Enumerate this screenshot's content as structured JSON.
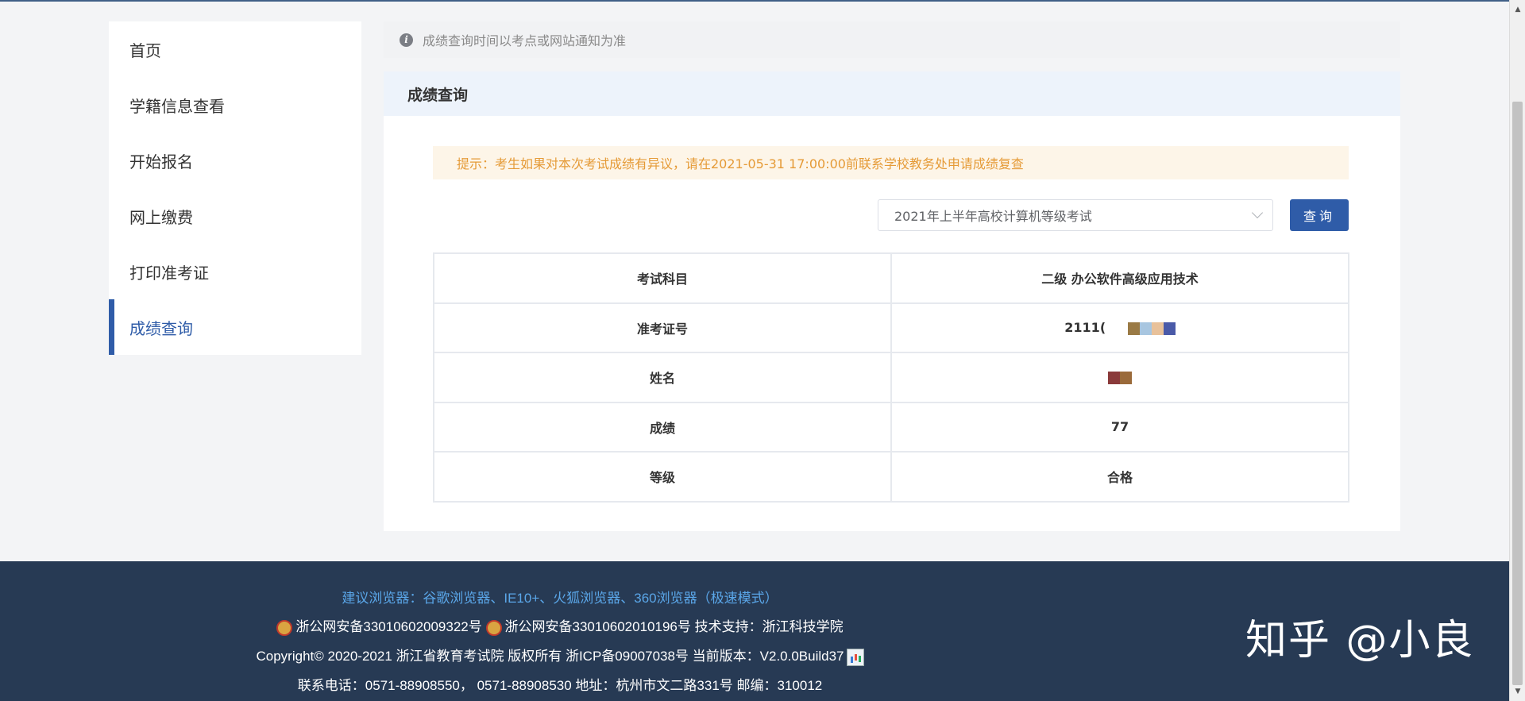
{
  "sidebar": {
    "items": [
      {
        "label": "首页"
      },
      {
        "label": "学籍信息查看"
      },
      {
        "label": "开始报名"
      },
      {
        "label": "网上缴费"
      },
      {
        "label": "打印准考证"
      },
      {
        "label": "成绩查询"
      }
    ],
    "active": "成绩查询"
  },
  "notice": {
    "text": "成绩查询时间以考点或网站通知为准"
  },
  "panel": {
    "title": "成绩查询",
    "tip": "提示：考生如果对本次考试成绩有异议，请在2021-05-31 17:00:00前联系学校教务处申请成绩复查",
    "exam_select_value": "2021年上半年高校计算机等级考试",
    "query_label": "查询"
  },
  "result": {
    "rows": [
      {
        "label": "考试科目",
        "value": "二级 办公软件高级应用技术"
      },
      {
        "label": "准考证号",
        "value": "2111("
      },
      {
        "label": "姓名",
        "value": ""
      },
      {
        "label": "成绩",
        "value": "77"
      },
      {
        "label": "等级",
        "value": "合格"
      }
    ]
  },
  "footer": {
    "browsers": "建议浏览器：谷歌浏览器、IE10+、火狐浏览器、360浏览器（极速模式）",
    "record1": "浙公网安备33010602009322号",
    "record2": "浙公网安备33010602010196号",
    "support": "技术支持：浙江科技学院",
    "copyright": "Copyright© 2020-2021 浙江省教育考试院 版权所有 浙ICP备09007038号 当前版本：V2.0.0Build37",
    "contact": "联系电话：0571-88908550，  0571-88908530 地址：杭州市文二路331号 邮编：310012"
  },
  "watermark": "知乎 @小良",
  "colors": {
    "primary": "#2f5ca8",
    "footer_bg": "#273a54",
    "tip_text": "#e59a36",
    "link": "#5aa6e8"
  }
}
